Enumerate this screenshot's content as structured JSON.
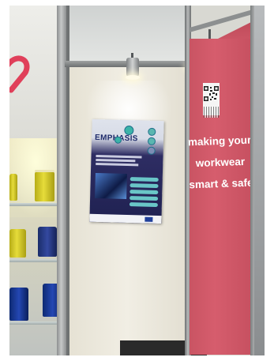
{
  "photo": {
    "poster": {
      "logo_text": "EMPHASIS"
    },
    "banner": {
      "slogan_lines": [
        "making your",
        "workwear",
        "smart & safe"
      ]
    },
    "colors": {
      "banner_red": "#d65d6d",
      "poster_navy": "#1f2151",
      "spool_yellow": "#e6dc3a",
      "spool_blue": "#2447b3"
    }
  }
}
